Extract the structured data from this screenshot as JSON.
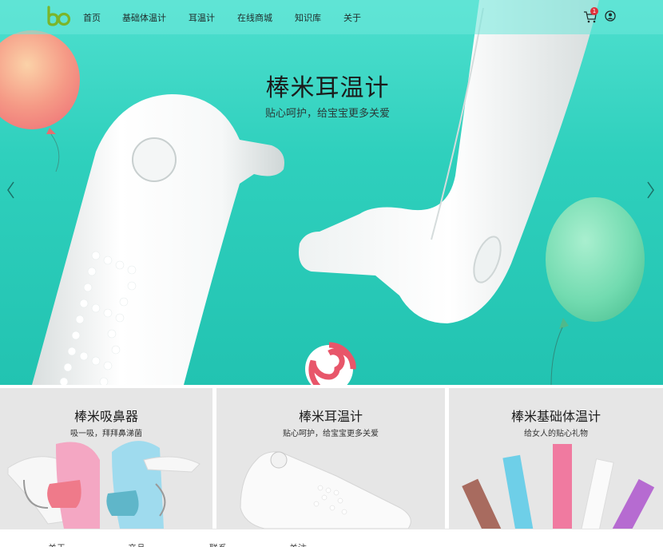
{
  "nav": {
    "logo_icon": "bo-logo-icon",
    "links": [
      "首页",
      "基础体温计",
      "耳温计",
      "在线商城",
      "知识库",
      "关于"
    ],
    "cart_icon": "cart-icon",
    "cart_count": "1",
    "user_icon": "user-circle-icon"
  },
  "hero": {
    "title": "棒米耳温计",
    "subtitle": "贴心呵护，给宝宝更多关爱",
    "prev_icon": "chevron-left-icon",
    "next_icon": "chevron-right-icon"
  },
  "cards": [
    {
      "title": "棒米吸鼻器",
      "subtitle": "吸一吸，拜拜鼻涕菌"
    },
    {
      "title": "棒米耳温计",
      "subtitle": "贴心呵护，给宝宝更多关爱"
    },
    {
      "title": "棒米基础体温计",
      "subtitle": "给女人的贴心礼物"
    }
  ],
  "footer": {
    "links": [
      "关于",
      "产品",
      "联系",
      "关注"
    ]
  },
  "colors": {
    "hero_bg": "#2fd0bd",
    "nav_bg": "#6ee8da",
    "card_bg": "#e6e6e6",
    "logo_green": "#7bb52a",
    "badge": "#e0303a"
  }
}
